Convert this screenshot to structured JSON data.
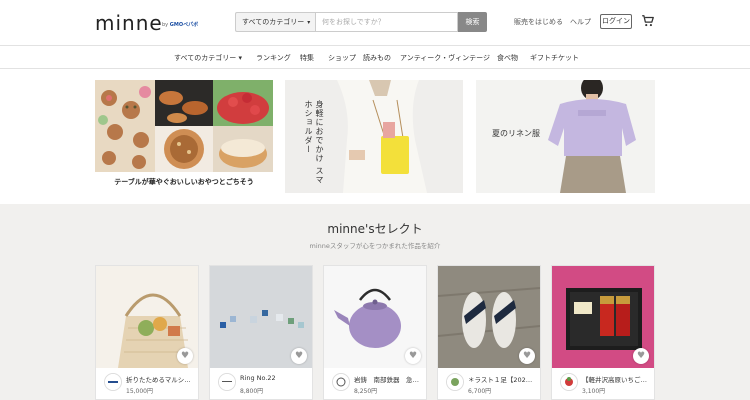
{
  "header": {
    "logo_text": "minne",
    "logo_sub_prefix": "by",
    "logo_sub_brand": "GMOペパボ",
    "category_select": "すべてのカテゴリー",
    "search_placeholder": "何をお探しですか？",
    "search_button": "検索",
    "links": {
      "start_selling": "販売をはじめる",
      "help": "ヘルプ",
      "login": "ログイン"
    }
  },
  "nav": {
    "items": [
      "すべてのカテゴリー ▾",
      "ランキング",
      "特集",
      "ショップ",
      "読みもの",
      "アンティーク・ヴィンテージ",
      "食べ物",
      "ギフトチケット"
    ]
  },
  "banners": [
    {
      "label": "テーブルが華やぐおいしいおやつとごちそう"
    },
    {
      "label": "身軽におでかけ スマホショルダー"
    },
    {
      "label": "夏のリネン服"
    }
  ],
  "select": {
    "title": "minne'sセレクト",
    "subtitle": "minneスタッフが心をつかまれた作品を紹介",
    "cards": [
      {
        "title": "折りたためるマルシェ…",
        "price": "15,000円"
      },
      {
        "title": "Ring No.22",
        "price": "8,800円"
      },
      {
        "title": "岩鋳　南部鉄器　急…",
        "price": "8,250円"
      },
      {
        "title": "＊ラスト１足【2022…",
        "price": "6,700円"
      },
      {
        "title": "【軽井沢高原いちご…",
        "price": "3,100円"
      }
    ]
  },
  "colors": {
    "select_bg": "#f1f0ee",
    "search_button": "#888888"
  }
}
